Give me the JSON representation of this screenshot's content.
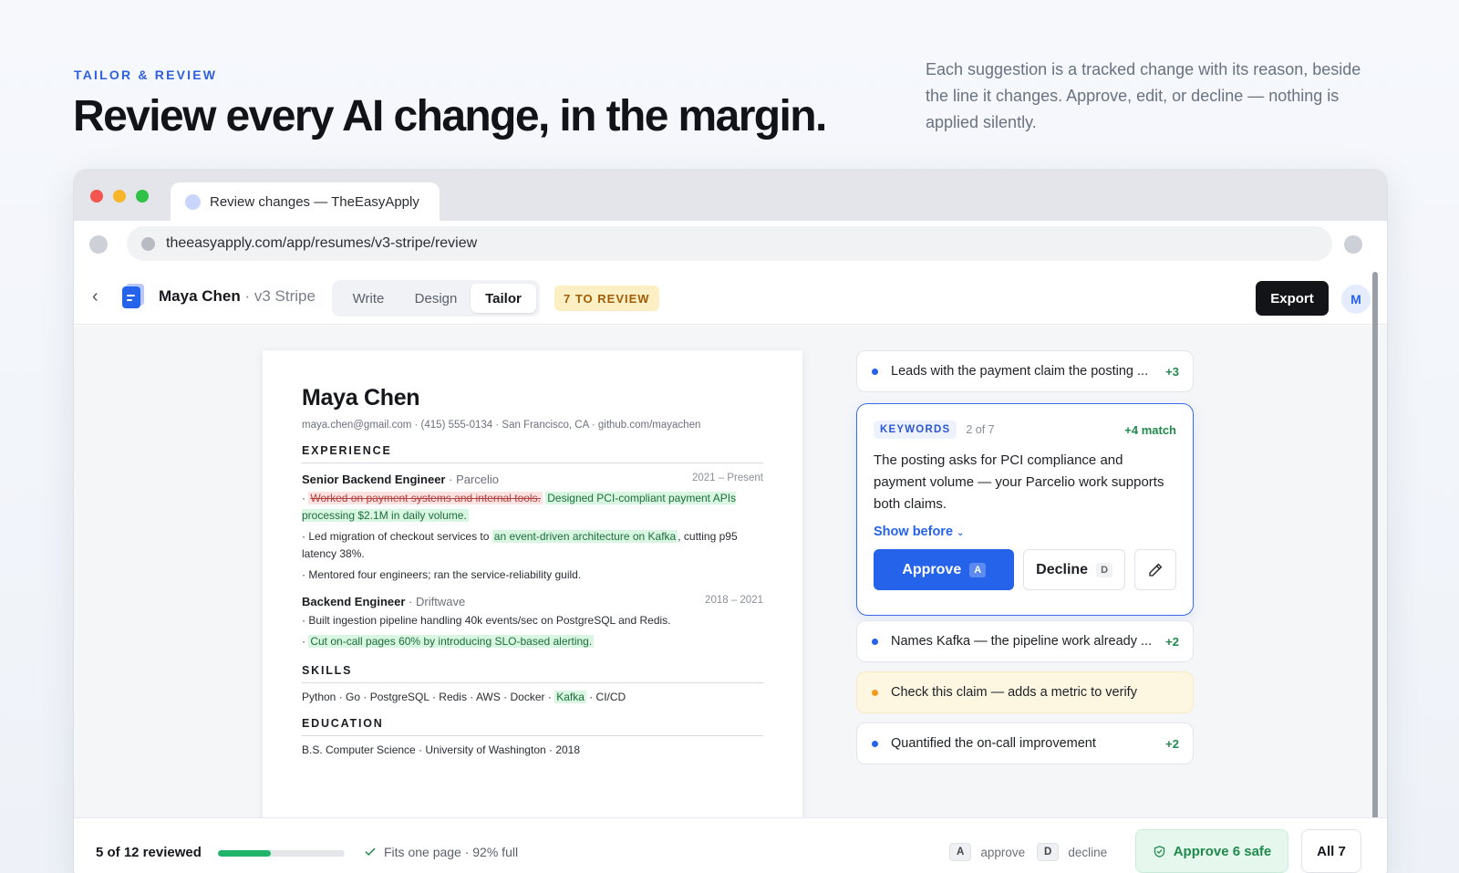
{
  "hero": {
    "eyebrow": "TAILOR & REVIEW",
    "headline": "Review every AI change, in the margin.",
    "lede": "Each suggestion is a tracked change with its reason, beside the line it changes. Approve, edit, or decline — nothing is applied silently."
  },
  "browser": {
    "tab_title": "Review changes — TheEasyApply",
    "url": "theeasyapply.com/app/resumes/v3-stripe/review"
  },
  "header": {
    "doc_name": "Maya Chen",
    "doc_version": " · v3 Stripe",
    "tabs": [
      {
        "label": "Write"
      },
      {
        "label": "Design"
      },
      {
        "label": "Tailor"
      }
    ],
    "active_tab": "Tailor",
    "review_badge": "7 TO REVIEW",
    "export_label": "Export",
    "avatar_initial": "M"
  },
  "resume": {
    "name": "Maya Chen",
    "contact": "maya.chen@gmail.com · (415) 555-0134 · San Francisco, CA · github.com/mayachen",
    "experience_heading": "EXPERIENCE",
    "jobs": [
      {
        "title": "Senior Backend Engineer",
        "company": "Parcelio",
        "dates": "2021 – Present",
        "b1_deleted": "Worked on payment systems and internal tools.",
        "b1_added": "Designed PCI-compliant payment APIs processing $2.1M in daily volume.",
        "b2_pre": "Led migration of checkout services to ",
        "b2_added": "an event-driven architecture on Kafka",
        "b2_post": ", cutting p95 latency 38%.",
        "b3": "Mentored four engineers; ran the service-reliability guild."
      },
      {
        "title": "Backend Engineer",
        "company": "Driftwave",
        "dates": "2018 – 2021",
        "b1": "Built ingestion pipeline handling 40k events/sec on PostgreSQL and Redis.",
        "b2_added": "Cut on-call pages 60% by introducing SLO-based alerting."
      }
    ],
    "skills_heading": "SKILLS",
    "skills_pre": "Python · Go · PostgreSQL · Redis · AWS · Docker · ",
    "skills_added": "Kafka",
    "skills_post": " · CI/CD",
    "education_heading": "EDUCATION",
    "education": "B.S. Computer Science · University of Washington · 2018"
  },
  "suggestions": {
    "s1": {
      "text": "Leads with the payment claim the posting ...",
      "points": "+3"
    },
    "active": {
      "tag": "KEYWORDS",
      "counter": "2 of 7",
      "match": "+4 match",
      "body": "The posting asks for PCI compliance and payment volume — your Parcelio work supports both claims.",
      "show_before": "Show before",
      "approve_label": "Approve",
      "approve_key": "A",
      "decline_label": "Decline",
      "decline_key": "D"
    },
    "s3": {
      "text": "Names Kafka — the pipeline work already ...",
      "points": "+2"
    },
    "s4": {
      "text": "Check this claim — adds a metric to verify"
    },
    "s5": {
      "text": "Quantified the on-call improvement",
      "points": "+2"
    }
  },
  "footer": {
    "reviewed": "5 of 12 reviewed",
    "progress_fraction": 0.42,
    "fits": "Fits one page · 92% full",
    "hint_approve_key": "A",
    "hint_approve": "approve",
    "hint_decline_key": "D",
    "hint_decline": "decline",
    "approve_safe": "Approve 6 safe",
    "all": "All 7"
  },
  "colors": {
    "accent": "#2563eb",
    "success": "#1f8a4c",
    "warning": "#f39a1d",
    "deleted": "#b3403f"
  }
}
